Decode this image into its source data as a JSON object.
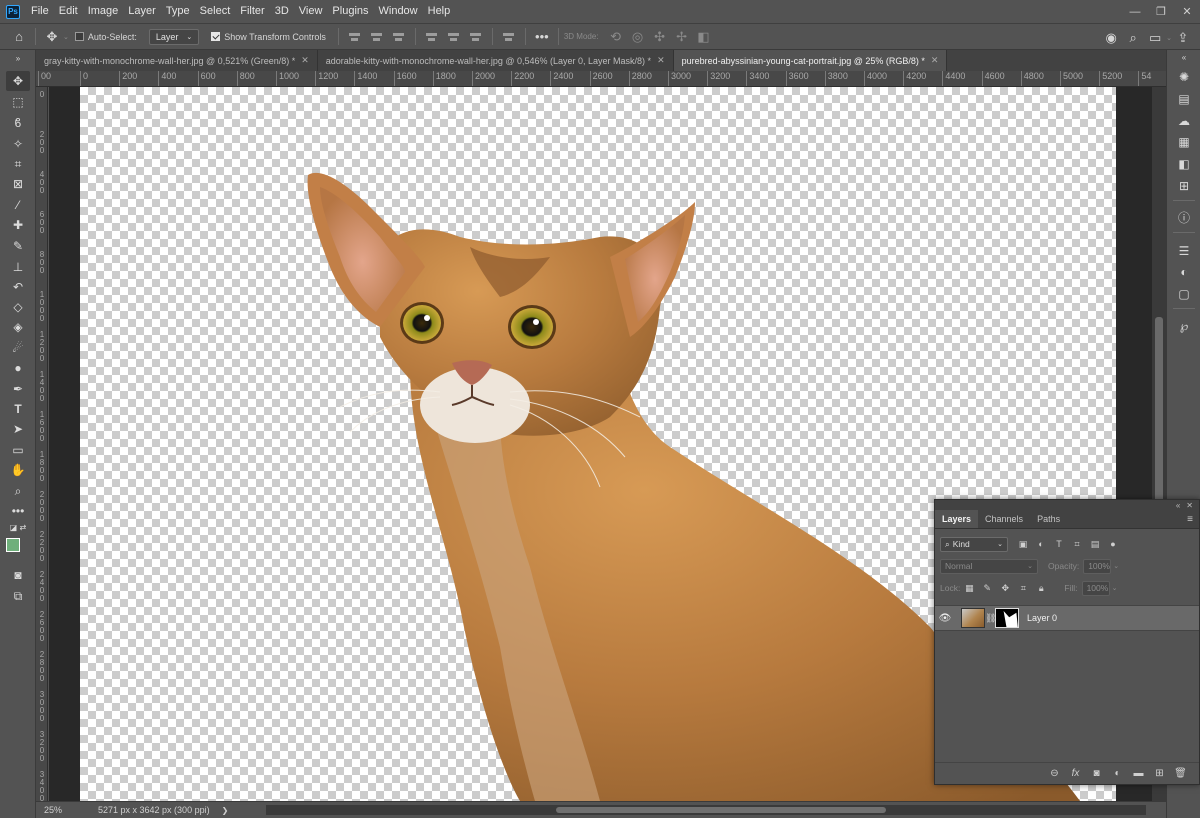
{
  "app": {
    "logo_text": "Ps"
  },
  "menu": [
    "File",
    "Edit",
    "Image",
    "Layer",
    "Type",
    "Select",
    "Filter",
    "3D",
    "View",
    "Plugins",
    "Window",
    "Help"
  ],
  "window_controls": {
    "minimize": "—",
    "restore": "❐",
    "close": "✕"
  },
  "options": {
    "auto_select_label": "Auto-Select:",
    "auto_select_checked": false,
    "target_value": "Layer",
    "show_transform_label": "Show Transform Controls",
    "show_transform_checked": true,
    "mode_3d_label": "3D Mode:"
  },
  "tabs": [
    {
      "label": "gray-kitty-with-monochrome-wall-her.jpg @ 0,521% (Green/8) *",
      "active": false
    },
    {
      "label": "adorable-kitty-with-monochrome-wall-her.jpg @ 0,546% (Layer 0, Layer Mask/8) *",
      "active": false
    },
    {
      "label": "purebred-abyssinian-young-cat-portrait.jpg @ 25% (RGB/8) *",
      "active": true
    }
  ],
  "ruler_h": [
    "00",
    "0",
    "200",
    "400",
    "600",
    "800",
    "1000",
    "1200",
    "1400",
    "1600",
    "1800",
    "2000",
    "2200",
    "2400",
    "2600",
    "2800",
    "3000",
    "3200",
    "3400",
    "3600",
    "3800",
    "4000",
    "4200",
    "4400",
    "4600",
    "4800",
    "5000",
    "5200",
    "54"
  ],
  "ruler_v": [
    "0",
    "2\n0\n0",
    "4\n0\n0",
    "6\n0\n0",
    "8\n0\n0",
    "1\n0\n0\n0",
    "1\n2\n0\n0",
    "1\n4\n0\n0",
    "1\n6\n0\n0",
    "1\n8\n0\n0",
    "2\n0\n0\n0",
    "2\n2\n0\n0",
    "2\n4\n0\n0",
    "2\n6\n0\n0",
    "2\n8\n0\n0",
    "3\n0\n0\n0",
    "3\n2\n0\n0",
    "3\n4\n0\n0"
  ],
  "status": {
    "zoom": "25%",
    "doc_info": "5271 px x 3642 px (300 ppi)",
    "arrow": "❯"
  },
  "layers_panel": {
    "tabs": [
      "Layers",
      "Channels",
      "Paths"
    ],
    "active_tab": "Layers",
    "filter_kind": "Kind",
    "blend_mode": "Normal",
    "opacity_label": "Opacity:",
    "opacity_value": "100%",
    "lock_label": "Lock:",
    "fill_label": "Fill:",
    "fill_value": "100%",
    "layers": [
      {
        "name": "Layer 0",
        "visible": true,
        "has_mask": true
      }
    ],
    "collapse": "«",
    "close": "✕"
  },
  "colors": {
    "foreground": "#6faf7b",
    "background": "#ffffff",
    "ui_bg": "#535353",
    "canvas_bg": "#282828"
  }
}
